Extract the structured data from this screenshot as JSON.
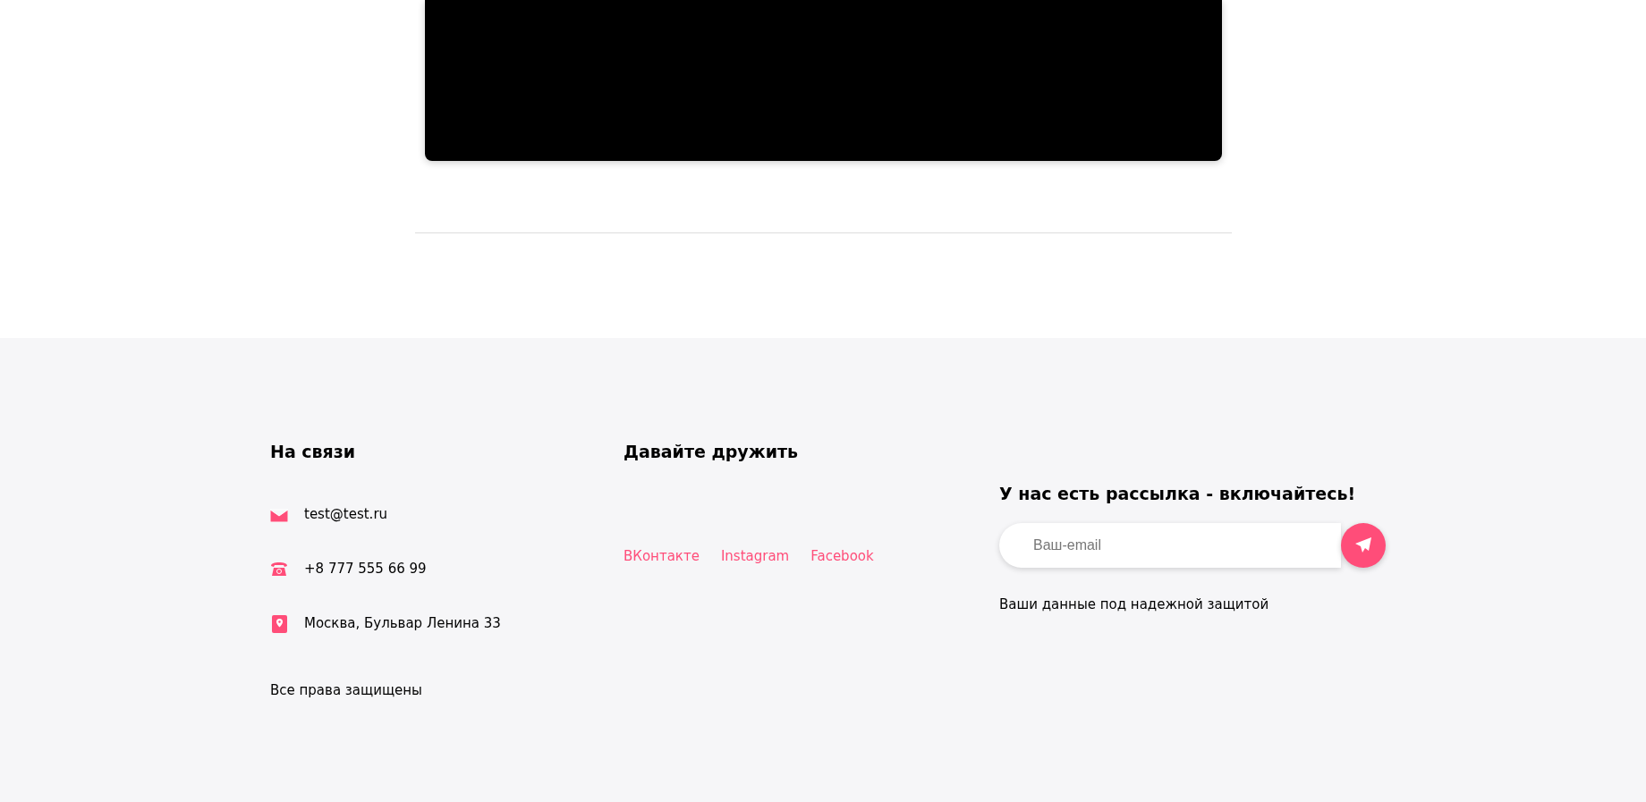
{
  "video": {
    "kind": "video"
  },
  "footer": {
    "contacts": {
      "title": "На связи",
      "items": [
        {
          "kind": "email",
          "text": "test@test.ru"
        },
        {
          "kind": "phone",
          "text": "+8 777 555 66 99"
        },
        {
          "kind": "address",
          "text": "Москва, Бульвар Ленина 33"
        }
      ],
      "copyright": "Все права защищены"
    },
    "social": {
      "title": "Давайте дружить",
      "links": [
        "ВКонтакте",
        "Instagram",
        "Facebook"
      ]
    },
    "newsletter": {
      "title": "У нас есть рассылка - включайтесь!",
      "placeholder": "Ваш-email",
      "note": "Ваши данные под надежной защитой"
    }
  }
}
